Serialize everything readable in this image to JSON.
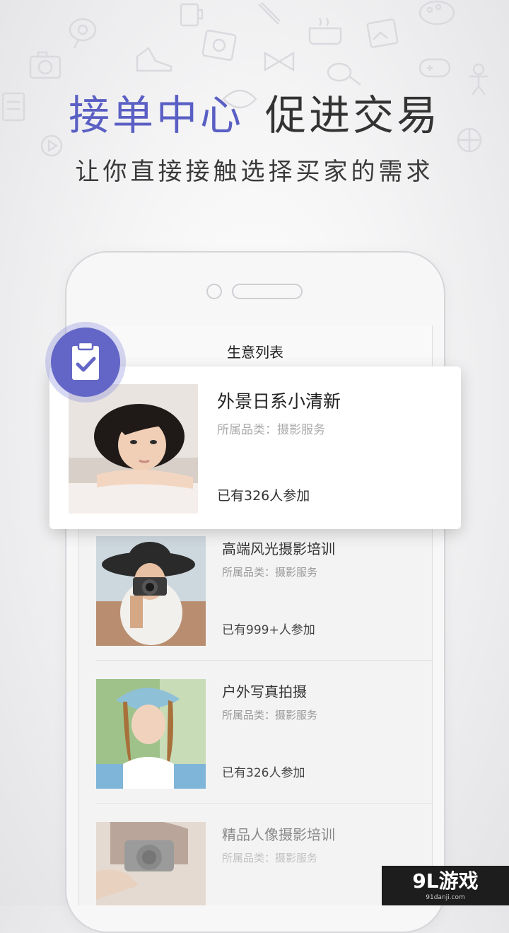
{
  "headline": {
    "accent": "接单中心",
    "rest": "促进交易"
  },
  "subheadline": "让你直接接触选择买家的需求",
  "screen": {
    "title": "生意列表",
    "featured": {
      "title": "外景日系小清新",
      "category": "所属品类：摄影服务",
      "participants": "已有326人参加"
    },
    "items": [
      {
        "title": "高端风光摄影培训",
        "category": "所属品类：摄影服务",
        "participants": "已有999+人参加"
      },
      {
        "title": "户外写真拍摄",
        "category": "所属品类：摄影服务",
        "participants": "已有326人参加"
      },
      {
        "title": "精品人像摄影培训",
        "category": "所属品类：摄影服务"
      }
    ]
  },
  "badge_icon": "clipboard-check-icon",
  "watermark": {
    "logo": "9L游戏",
    "url": "91danji.com"
  },
  "colors": {
    "accent": "#5a5fc4",
    "badge": "#6366c6"
  }
}
